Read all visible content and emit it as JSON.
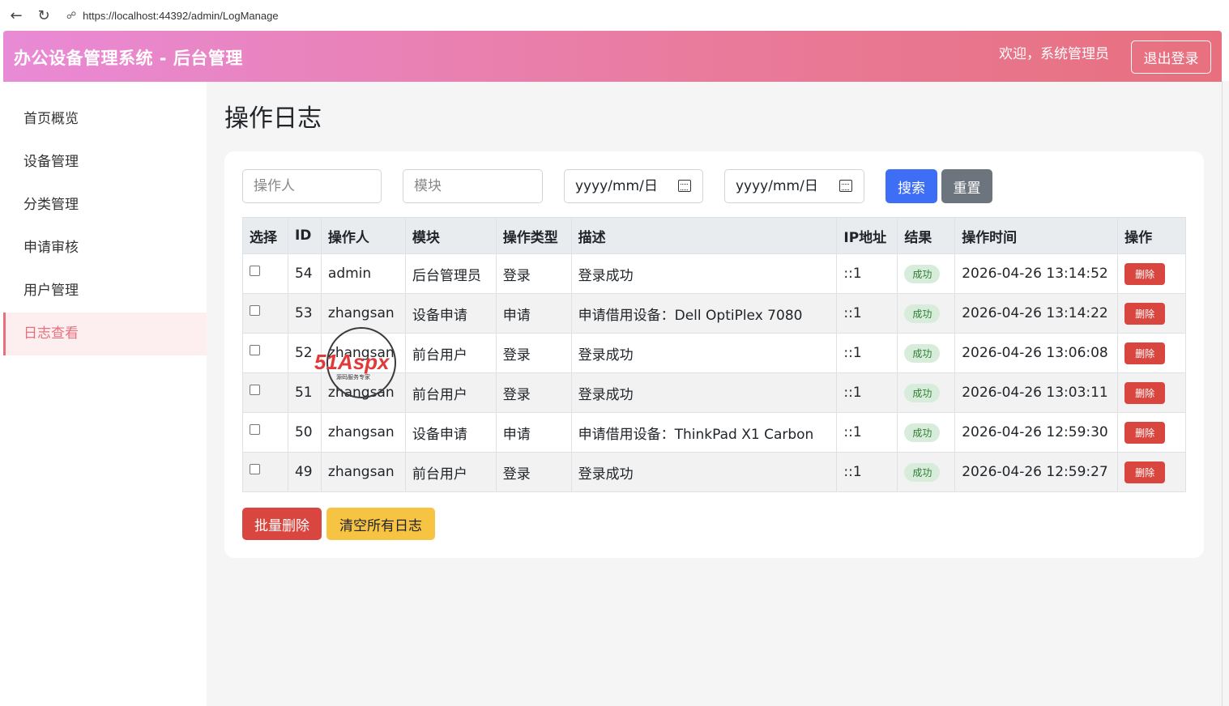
{
  "browser": {
    "url": "https://localhost:44392/admin/LogManage"
  },
  "header": {
    "brand": "办公设备管理系统 - 后台管理",
    "welcome": "欢迎，系统管理员",
    "logout_label": "退出登录"
  },
  "sidebar": {
    "items": [
      {
        "label": "首页概览"
      },
      {
        "label": "设备管理"
      },
      {
        "label": "分类管理"
      },
      {
        "label": "申请审核"
      },
      {
        "label": "用户管理"
      },
      {
        "label": "日志查看"
      }
    ],
    "active_index": 5
  },
  "page": {
    "title": "操作日志"
  },
  "filters": {
    "operator_placeholder": "操作人",
    "module_placeholder": "模块",
    "start_date": "yyyy/mm/日",
    "end_date": "yyyy/mm/日",
    "search_label": "搜索",
    "reset_label": "重置"
  },
  "table": {
    "headers": [
      "选择",
      "ID",
      "操作人",
      "模块",
      "操作类型",
      "描述",
      "IP地址",
      "结果",
      "操作时间",
      "操作"
    ],
    "rows": [
      {
        "id": "54",
        "operator": "admin",
        "module": "后台管理员",
        "type": "登录",
        "desc": "登录成功",
        "ip": "::1",
        "result": "成功",
        "time": "2026-04-26 13:14:52",
        "action": "删除"
      },
      {
        "id": "53",
        "operator": "zhangsan",
        "module": "设备申请",
        "type": "申请",
        "desc": "申请借用设备：Dell OptiPlex 7080",
        "ip": "::1",
        "result": "成功",
        "time": "2026-04-26 13:14:22",
        "action": "删除"
      },
      {
        "id": "52",
        "operator": "zhangsan",
        "module": "前台用户",
        "type": "登录",
        "desc": "登录成功",
        "ip": "::1",
        "result": "成功",
        "time": "2026-04-26 13:06:08",
        "action": "删除"
      },
      {
        "id": "51",
        "operator": "zhangsan",
        "module": "前台用户",
        "type": "登录",
        "desc": "登录成功",
        "ip": "::1",
        "result": "成功",
        "time": "2026-04-26 13:03:11",
        "action": "删除"
      },
      {
        "id": "50",
        "operator": "zhangsan",
        "module": "设备申请",
        "type": "申请",
        "desc": "申请借用设备：ThinkPad X1 Carbon",
        "ip": "::1",
        "result": "成功",
        "time": "2026-04-26 12:59:30",
        "action": "删除"
      },
      {
        "id": "49",
        "operator": "zhangsan",
        "module": "前台用户",
        "type": "登录",
        "desc": "登录成功",
        "ip": "::1",
        "result": "成功",
        "time": "2026-04-26 12:59:27",
        "action": "删除"
      }
    ]
  },
  "footer_actions": {
    "batch_delete_label": "批量删除",
    "clear_all_label": "清空所有日志"
  },
  "watermark": {
    "text": "51Aspx",
    "subtext": "源码服务专家"
  },
  "colors": {
    "header_start": "#e98ad6",
    "header_end": "#e8707e",
    "active_item": "#e8707e",
    "search_button": "#3d6ef5",
    "delete_button": "#d9463f",
    "clear_button": "#f6c342"
  }
}
